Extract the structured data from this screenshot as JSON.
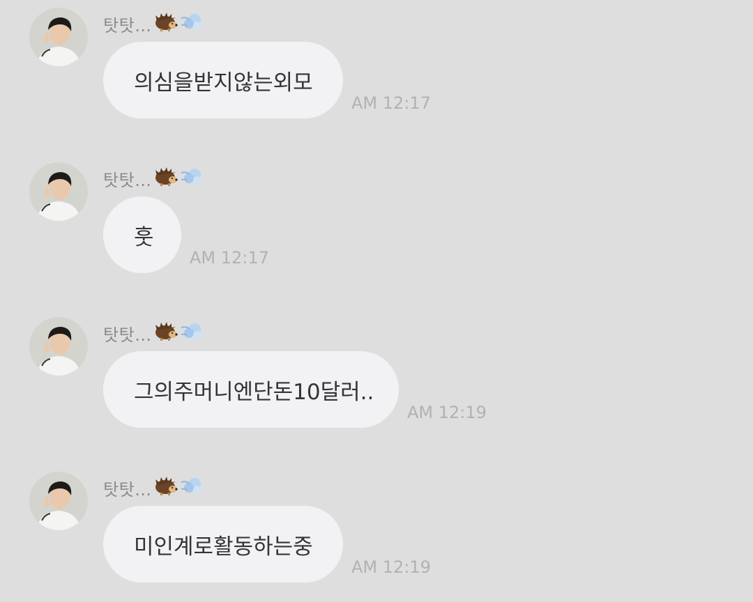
{
  "sender": {
    "name": "탓탓…",
    "emojis": [
      "hedgehog-icon",
      "dash-icon"
    ]
  },
  "messages": [
    {
      "text": "의심을받지않는외모",
      "time": "AM 12:17"
    },
    {
      "text": "훗",
      "time": "AM 12:17"
    },
    {
      "text": "그의주머니엔단돈10달러..",
      "time": "AM 12:19"
    },
    {
      "text": "미인계로활동하는중",
      "time": "AM 12:19"
    }
  ],
  "colors": {
    "background": "#dedede",
    "bubble": "#f2f2f4",
    "message_text": "#333338",
    "sender_text": "#8c8c8c",
    "time_text": "#b1b1b6"
  }
}
